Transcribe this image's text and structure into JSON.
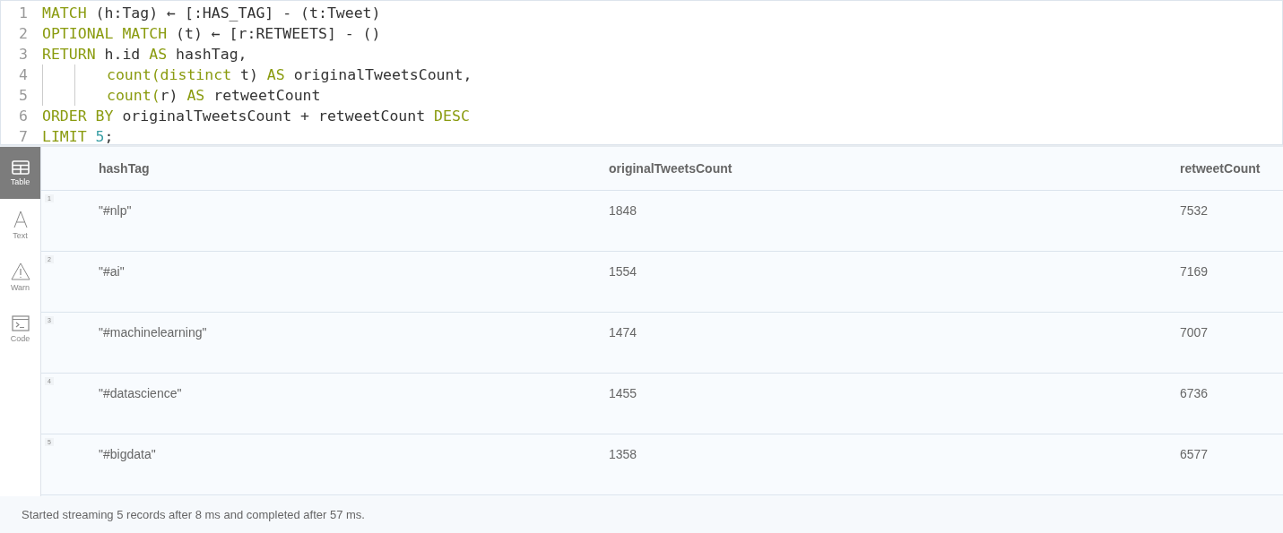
{
  "editor": {
    "lines": [
      {
        "number": "1",
        "indented": false,
        "tokens": [
          {
            "kind": "keyword",
            "text": "MATCH"
          },
          {
            "kind": "plain",
            "text": " (h:Tag) ← [:HAS_TAG] - (t:Tweet)"
          }
        ]
      },
      {
        "number": "2",
        "indented": false,
        "tokens": [
          {
            "kind": "keyword",
            "text": "OPTIONAL MATCH"
          },
          {
            "kind": "plain",
            "text": " (t) ← [r:RETWEETS] - ()"
          }
        ]
      },
      {
        "number": "3",
        "indented": false,
        "tokens": [
          {
            "kind": "keyword",
            "text": "RETURN"
          },
          {
            "kind": "plain",
            "text": " h.id "
          },
          {
            "kind": "keyword",
            "text": "AS"
          },
          {
            "kind": "plain",
            "text": " hashTag,"
          }
        ]
      },
      {
        "number": "4",
        "indented": true,
        "tokens": [
          {
            "kind": "keyword",
            "text": "count(distinct"
          },
          {
            "kind": "plain",
            "text": " t) "
          },
          {
            "kind": "keyword",
            "text": "AS"
          },
          {
            "kind": "plain",
            "text": " originalTweetsCount,"
          }
        ]
      },
      {
        "number": "5",
        "indented": true,
        "tokens": [
          {
            "kind": "keyword",
            "text": "count("
          },
          {
            "kind": "plain",
            "text": "r) "
          },
          {
            "kind": "keyword",
            "text": "AS"
          },
          {
            "kind": "plain",
            "text": " retweetCount"
          }
        ]
      },
      {
        "number": "6",
        "indented": false,
        "tokens": [
          {
            "kind": "keyword",
            "text": "ORDER BY"
          },
          {
            "kind": "plain",
            "text": " originalTweetsCount + retweetCount "
          },
          {
            "kind": "keyword",
            "text": "DESC"
          }
        ]
      },
      {
        "number": "7",
        "indented": false,
        "tokens": [
          {
            "kind": "keyword",
            "text": "LIMIT"
          },
          {
            "kind": "number",
            "text": " 5"
          },
          {
            "kind": "plain",
            "text": ";"
          }
        ]
      }
    ]
  },
  "views": [
    {
      "kind": "table",
      "label": "Table",
      "selected": true
    },
    {
      "kind": "text",
      "label": "Text",
      "selected": false
    },
    {
      "kind": "warn",
      "label": "Warn",
      "selected": false
    },
    {
      "kind": "code",
      "label": "Code",
      "selected": false
    }
  ],
  "table": {
    "columns": [
      "hashTag",
      "originalTweetsCount",
      "retweetCount"
    ],
    "rows": [
      {
        "index": "1",
        "cells": [
          "\"#nlp\"",
          "1848",
          "7532"
        ]
      },
      {
        "index": "2",
        "cells": [
          "\"#ai\"",
          "1554",
          "7169"
        ]
      },
      {
        "index": "3",
        "cells": [
          "\"#machinelearning\"",
          "1474",
          "7007"
        ]
      },
      {
        "index": "4",
        "cells": [
          "\"#datascience\"",
          "1455",
          "6736"
        ]
      },
      {
        "index": "5",
        "cells": [
          "\"#bigdata\"",
          "1358",
          "6577"
        ]
      }
    ]
  },
  "status_bar": "Started streaming 5 records after 8 ms and completed after 57 ms."
}
